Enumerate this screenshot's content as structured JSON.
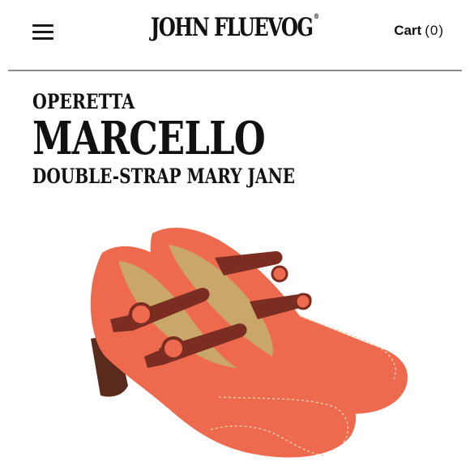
{
  "header": {
    "brand": "JOHN FLUEVOG",
    "brand_mark": "®",
    "cart_label": "Cart",
    "cart_count": "(0)"
  },
  "product": {
    "collection": "OPERETTA",
    "name": "MARCELLO",
    "subtitle": "DOUBLE-STRAP MARY JANE"
  },
  "colors": {
    "shoe_coral": "#ee6a4f",
    "strap_brown": "#7a2d20",
    "heel_brown": "#5a2a1c",
    "insole_tan": "#c9a76a",
    "stitching": "#f7c9a8",
    "rule": "#8d8d8d"
  },
  "icons": {
    "menu": "hamburger-menu-icon"
  }
}
